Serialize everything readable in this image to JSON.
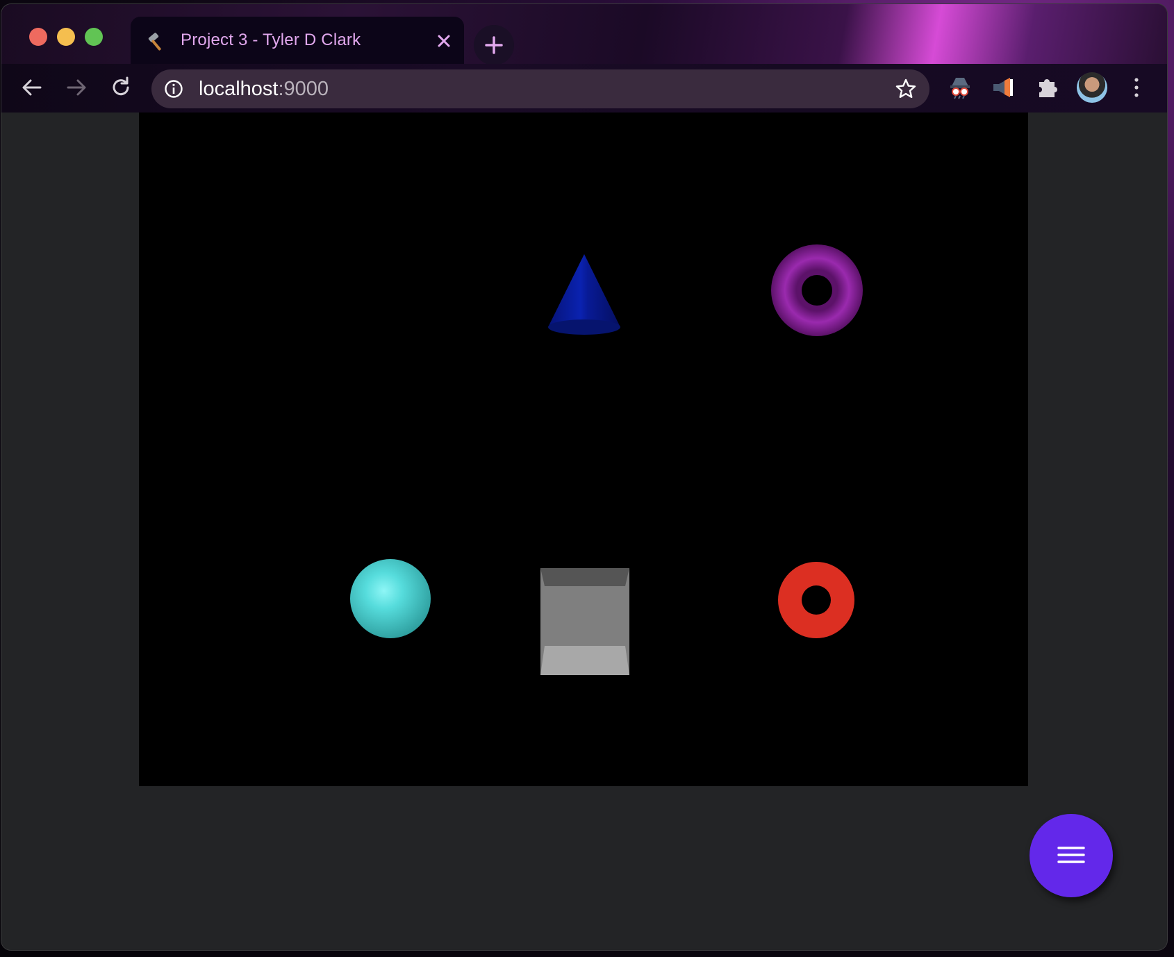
{
  "browser": {
    "tab": {
      "title": "Project 3 - Tyler D Clark",
      "favicon": "hammer-icon",
      "close_icon": "close-icon"
    },
    "new_tab_icon": "plus-icon",
    "toolbar": {
      "back_icon": "arrow-left-icon",
      "forward_icon": "arrow-right-icon",
      "reload_icon": "reload-icon",
      "url_host": "localhost",
      "url_port": ":9000",
      "info_icon": "info-icon",
      "bookmark_icon": "star-icon",
      "extensions": [
        "spy-extension-icon",
        "megaphone-extension-icon",
        "puzzle-icon"
      ],
      "menu_icon": "kebab-menu-icon"
    }
  },
  "scene": {
    "objects": [
      {
        "name": "cone",
        "color": "#0a1fa0"
      },
      {
        "name": "torus-purple",
        "color": "#8a1f9a"
      },
      {
        "name": "sphere",
        "color": "#5fd8d8"
      },
      {
        "name": "cube",
        "color": "#8a8a8a"
      },
      {
        "name": "torus-red",
        "color": "#dc2f22"
      }
    ]
  },
  "fab": {
    "icon": "hamburger-menu-icon",
    "color": "#6328ea"
  }
}
